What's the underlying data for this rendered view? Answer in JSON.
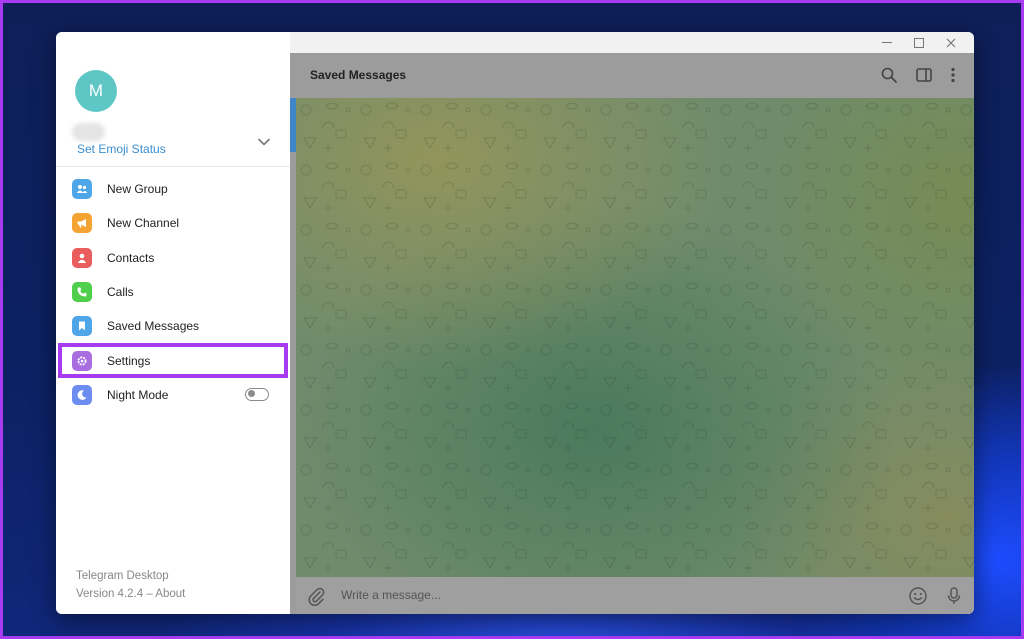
{
  "window": {
    "controls": {
      "minimize": "minimize",
      "maximize": "maximize",
      "close": "close"
    }
  },
  "profile": {
    "avatar_letter": "M",
    "emoji_status": "Set Emoji Status"
  },
  "menu": {
    "items": [
      {
        "label": "New Group",
        "icon": "group-icon",
        "color": "#4ea6e8"
      },
      {
        "label": "New Channel",
        "icon": "megaphone-icon",
        "color": "#f4a433"
      },
      {
        "label": "Contacts",
        "icon": "person-icon",
        "color": "#ea5d5d"
      },
      {
        "label": "Calls",
        "icon": "phone-icon",
        "color": "#4fcf4b"
      },
      {
        "label": "Saved Messages",
        "icon": "bookmark-icon",
        "color": "#4ea6e8"
      },
      {
        "label": "Settings",
        "icon": "gear-icon",
        "color": "#a86ee0"
      },
      {
        "label": "Night Mode",
        "icon": "moon-icon",
        "color": "#6c8cf0"
      }
    ],
    "night_mode_on": false
  },
  "footer": {
    "app_name": "Telegram Desktop",
    "version": "Version 4.2.4 – About"
  },
  "chat": {
    "title": "Saved Messages",
    "composer_placeholder": "Write a message..."
  },
  "colors": {
    "highlight": "#a63bf2",
    "link": "#3a8fd0"
  }
}
